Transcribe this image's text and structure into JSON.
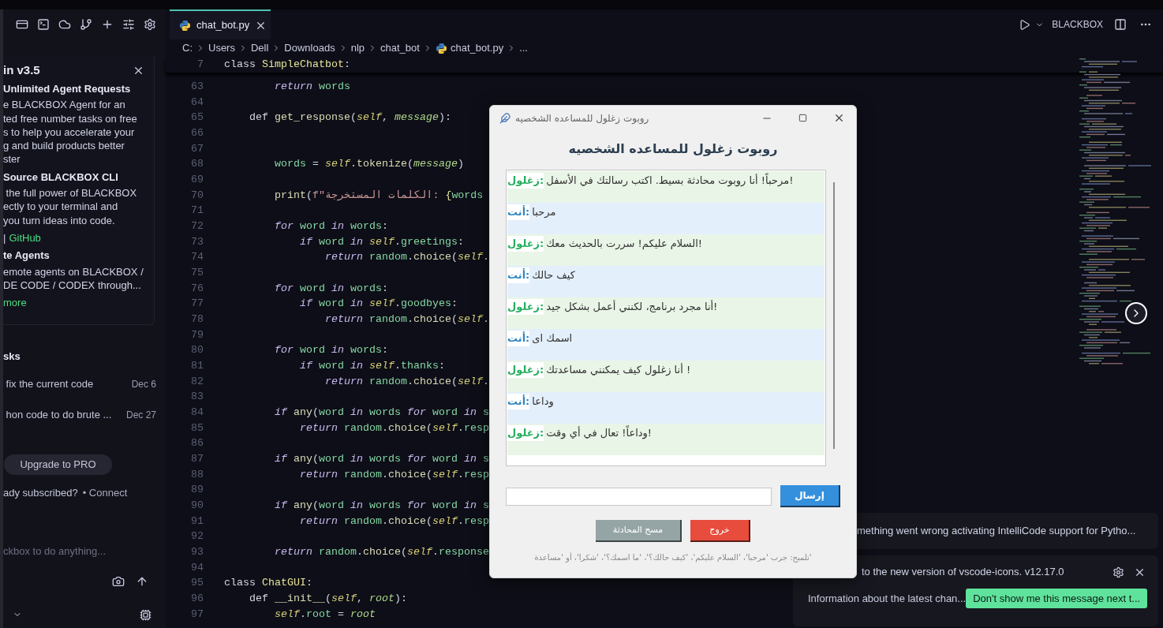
{
  "editor": {
    "tabs": [
      {
        "label": "chat_bot.py",
        "selected": true
      }
    ],
    "toolbar": {
      "label": "BLACKBOX"
    },
    "breadcrumbs": [
      {
        "label": "C:",
        "kind": "folder"
      },
      {
        "label": "Users",
        "kind": "folder"
      },
      {
        "label": "Dell",
        "kind": "folder"
      },
      {
        "label": "Downloads",
        "kind": "folder"
      },
      {
        "label": "nlp",
        "kind": "folder"
      },
      {
        "label": "chat_bot",
        "kind": "folder"
      },
      {
        "label": "chat_bot.py",
        "kind": "file"
      },
      {
        "label": "...",
        "kind": "more"
      }
    ],
    "sticky_lines": [
      {
        "number": "7",
        "code": [
          {
            "kind": "decl",
            "text": "class "
          },
          {
            "kind": "cls",
            "text": "SimpleChatbot"
          },
          {
            "kind": "p",
            "text": ":"
          }
        ]
      }
    ],
    "lines": [
      {
        "number": "63",
        "code": [
          {
            "kind": "kw",
            "text": "        return "
          },
          {
            "kind": "id",
            "text": "words"
          }
        ]
      },
      {
        "number": "64"
      },
      {
        "number": "65",
        "code": [
          {
            "kind": "decl",
            "text": "    def "
          },
          {
            "kind": "fn",
            "text": "get_response"
          },
          {
            "kind": "p",
            "text": "("
          },
          {
            "kind": "self",
            "text": "self"
          },
          {
            "kind": "p",
            "text": ", "
          },
          {
            "kind": "param",
            "text": "message"
          },
          {
            "kind": "p",
            "text": "):"
          }
        ]
      },
      {
        "number": "66"
      },
      {
        "number": "67"
      },
      {
        "number": "68",
        "code": [
          {
            "kind": "id",
            "text": "        words"
          },
          {
            "kind": "p",
            "text": " = "
          },
          {
            "kind": "self",
            "text": "self"
          },
          {
            "kind": "p",
            "text": "."
          },
          {
            "kind": "fn",
            "text": "tokenize"
          },
          {
            "kind": "p",
            "text": "("
          },
          {
            "kind": "param",
            "text": "message"
          },
          {
            "kind": "p",
            "text": ")"
          }
        ]
      },
      {
        "number": "69"
      },
      {
        "number": "70",
        "code": [
          {
            "kind": "fn",
            "text": "        print"
          },
          {
            "kind": "p",
            "text": "("
          },
          {
            "kind": "str",
            "text": "f\"الكلمات المستخرجة: "
          },
          {
            "kind": "cls",
            "text": "{"
          },
          {
            "kind": "id",
            "text": "words"
          }
        ]
      },
      {
        "number": "71"
      },
      {
        "number": "72",
        "code": [
          {
            "kind": "kw",
            "text": "        for "
          },
          {
            "kind": "id",
            "text": "word "
          },
          {
            "kind": "kw",
            "text": "in "
          },
          {
            "kind": "id",
            "text": "words"
          },
          {
            "kind": "p",
            "text": ":"
          }
        ]
      },
      {
        "number": "73",
        "code": [
          {
            "kind": "kw",
            "text": "            if "
          },
          {
            "kind": "id",
            "text": "word "
          },
          {
            "kind": "kw",
            "text": "in "
          },
          {
            "kind": "self",
            "text": "self"
          },
          {
            "kind": "p",
            "text": "."
          },
          {
            "kind": "id",
            "text": "greetings"
          },
          {
            "kind": "p",
            "text": ":"
          }
        ]
      },
      {
        "number": "74",
        "code": [
          {
            "kind": "kw",
            "text": "                return "
          },
          {
            "kind": "id",
            "text": "random"
          },
          {
            "kind": "p",
            "text": "."
          },
          {
            "kind": "fn",
            "text": "choice"
          },
          {
            "kind": "p",
            "text": "("
          },
          {
            "kind": "self",
            "text": "self"
          },
          {
            "kind": "p",
            "text": "."
          }
        ]
      },
      {
        "number": "75"
      },
      {
        "number": "76",
        "code": [
          {
            "kind": "kw",
            "text": "        for "
          },
          {
            "kind": "id",
            "text": "word "
          },
          {
            "kind": "kw",
            "text": "in "
          },
          {
            "kind": "id",
            "text": "words"
          },
          {
            "kind": "p",
            "text": ":"
          }
        ]
      },
      {
        "number": "77",
        "code": [
          {
            "kind": "kw",
            "text": "            if "
          },
          {
            "kind": "id",
            "text": "word "
          },
          {
            "kind": "kw",
            "text": "in "
          },
          {
            "kind": "self",
            "text": "self"
          },
          {
            "kind": "p",
            "text": "."
          },
          {
            "kind": "id",
            "text": "goodbyes"
          },
          {
            "kind": "p",
            "text": ":"
          }
        ]
      },
      {
        "number": "78",
        "code": [
          {
            "kind": "kw",
            "text": "                return "
          },
          {
            "kind": "id",
            "text": "random"
          },
          {
            "kind": "p",
            "text": "."
          },
          {
            "kind": "fn",
            "text": "choice"
          },
          {
            "kind": "p",
            "text": "("
          },
          {
            "kind": "self",
            "text": "self"
          },
          {
            "kind": "p",
            "text": "."
          }
        ]
      },
      {
        "number": "79"
      },
      {
        "number": "80",
        "code": [
          {
            "kind": "kw",
            "text": "        for "
          },
          {
            "kind": "id",
            "text": "word "
          },
          {
            "kind": "kw",
            "text": "in "
          },
          {
            "kind": "id",
            "text": "words"
          },
          {
            "kind": "p",
            "text": ":"
          }
        ]
      },
      {
        "number": "81",
        "code": [
          {
            "kind": "kw",
            "text": "            if "
          },
          {
            "kind": "id",
            "text": "word "
          },
          {
            "kind": "kw",
            "text": "in "
          },
          {
            "kind": "self",
            "text": "self"
          },
          {
            "kind": "p",
            "text": "."
          },
          {
            "kind": "id",
            "text": "thanks"
          },
          {
            "kind": "p",
            "text": ":"
          }
        ]
      },
      {
        "number": "82",
        "code": [
          {
            "kind": "kw",
            "text": "                return "
          },
          {
            "kind": "id",
            "text": "random"
          },
          {
            "kind": "p",
            "text": "."
          },
          {
            "kind": "fn",
            "text": "choice"
          },
          {
            "kind": "p",
            "text": "("
          },
          {
            "kind": "self",
            "text": "self"
          },
          {
            "kind": "p",
            "text": "."
          }
        ]
      },
      {
        "number": "83"
      },
      {
        "number": "84",
        "code": [
          {
            "kind": "kw",
            "text": "        if "
          },
          {
            "kind": "fn",
            "text": "any"
          },
          {
            "kind": "p",
            "text": "("
          },
          {
            "kind": "id",
            "text": "word "
          },
          {
            "kind": "kw",
            "text": "in "
          },
          {
            "kind": "id",
            "text": "words "
          },
          {
            "kind": "kw",
            "text": "for "
          },
          {
            "kind": "id",
            "text": "word "
          },
          {
            "kind": "kw",
            "text": "in "
          },
          {
            "kind": "id",
            "text": "s"
          }
        ]
      },
      {
        "number": "85",
        "code": [
          {
            "kind": "kw",
            "text": "            return "
          },
          {
            "kind": "id",
            "text": "random"
          },
          {
            "kind": "p",
            "text": "."
          },
          {
            "kind": "fn",
            "text": "choice"
          },
          {
            "kind": "p",
            "text": "("
          },
          {
            "kind": "self",
            "text": "self"
          },
          {
            "kind": "p",
            "text": "."
          },
          {
            "kind": "id",
            "text": "resp"
          }
        ]
      },
      {
        "number": "86"
      },
      {
        "number": "87",
        "code": [
          {
            "kind": "kw",
            "text": "        if "
          },
          {
            "kind": "fn",
            "text": "any"
          },
          {
            "kind": "p",
            "text": "("
          },
          {
            "kind": "id",
            "text": "word "
          },
          {
            "kind": "kw",
            "text": "in "
          },
          {
            "kind": "id",
            "text": "words "
          },
          {
            "kind": "kw",
            "text": "for "
          },
          {
            "kind": "id",
            "text": "word "
          },
          {
            "kind": "kw",
            "text": "in "
          },
          {
            "kind": "id",
            "text": "s"
          }
        ]
      },
      {
        "number": "88",
        "code": [
          {
            "kind": "kw",
            "text": "            return "
          },
          {
            "kind": "id",
            "text": "random"
          },
          {
            "kind": "p",
            "text": "."
          },
          {
            "kind": "fn",
            "text": "choice"
          },
          {
            "kind": "p",
            "text": "("
          },
          {
            "kind": "self",
            "text": "self"
          },
          {
            "kind": "p",
            "text": "."
          },
          {
            "kind": "id",
            "text": "resp"
          }
        ]
      },
      {
        "number": "89"
      },
      {
        "number": "90",
        "code": [
          {
            "kind": "kw",
            "text": "        if "
          },
          {
            "kind": "fn",
            "text": "any"
          },
          {
            "kind": "p",
            "text": "("
          },
          {
            "kind": "id",
            "text": "word "
          },
          {
            "kind": "kw",
            "text": "in "
          },
          {
            "kind": "id",
            "text": "words "
          },
          {
            "kind": "kw",
            "text": "for "
          },
          {
            "kind": "id",
            "text": "word "
          },
          {
            "kind": "kw",
            "text": "in "
          },
          {
            "kind": "id",
            "text": "s"
          }
        ]
      },
      {
        "number": "91",
        "code": [
          {
            "kind": "kw",
            "text": "            return "
          },
          {
            "kind": "id",
            "text": "random"
          },
          {
            "kind": "p",
            "text": "."
          },
          {
            "kind": "fn",
            "text": "choice"
          },
          {
            "kind": "p",
            "text": "("
          },
          {
            "kind": "self",
            "text": "self"
          },
          {
            "kind": "p",
            "text": "."
          },
          {
            "kind": "id",
            "text": "resp"
          }
        ]
      },
      {
        "number": "92"
      },
      {
        "number": "93",
        "code": [
          {
            "kind": "kw",
            "text": "        return "
          },
          {
            "kind": "id",
            "text": "random"
          },
          {
            "kind": "p",
            "text": "."
          },
          {
            "kind": "fn",
            "text": "choice"
          },
          {
            "kind": "p",
            "text": "("
          },
          {
            "kind": "self",
            "text": "self"
          },
          {
            "kind": "p",
            "text": "."
          },
          {
            "kind": "id",
            "text": "response"
          }
        ]
      },
      {
        "number": "94"
      },
      {
        "number": "95",
        "code": [
          {
            "kind": "decl",
            "text": "class "
          },
          {
            "kind": "cls",
            "text": "ChatGUI"
          },
          {
            "kind": "p",
            "text": ":"
          }
        ]
      },
      {
        "number": "96",
        "code": [
          {
            "kind": "decl",
            "text": "    def "
          },
          {
            "kind": "fn",
            "text": "__init__"
          },
          {
            "kind": "p",
            "text": "("
          },
          {
            "kind": "self",
            "text": "self"
          },
          {
            "kind": "p",
            "text": ", "
          },
          {
            "kind": "param",
            "text": "root"
          },
          {
            "kind": "p",
            "text": "):"
          }
        ]
      },
      {
        "number": "97",
        "code": [
          {
            "kind": "self",
            "text": "        self"
          },
          {
            "kind": "p",
            "text": "."
          },
          {
            "kind": "id",
            "text": "root"
          },
          {
            "kind": "p",
            "text": " = "
          },
          {
            "kind": "param",
            "text": "root"
          }
        ]
      }
    ]
  },
  "sidebar": {
    "announcement": {
      "title": "in v3.5",
      "sections": [
        {
          "heading": "Unlimited Agent Requests",
          "lines": [
            "e BLACKBOX Agent for an",
            "ted free number tasks on free",
            "s to help you accelerate your",
            "g and build products better",
            "ster"
          ]
        },
        {
          "heading": "Source BLACKBOX CLI",
          "lines": [
            " the full power of BLACKBOX",
            "ectly to your terminal and",
            "you turn ideas into code."
          ],
          "footer": {
            "prefix": "|",
            "link": "GitHub"
          }
        },
        {
          "heading": "te Agents",
          "lines": [
            "emote agents on BLACKBOX /",
            "DE CODE / CODEX through..."
          ],
          "footer": {
            "link": "more"
          }
        }
      ]
    },
    "tasks": {
      "heading": "sks",
      "items": [
        {
          "title": "fix the current code",
          "date": "Dec 6"
        },
        {
          "title": "hon code to do brute ...",
          "date": "Dec 27"
        }
      ]
    },
    "upgrade_button": "Upgrade to PRO",
    "subscribed": {
      "text": "ady subscribed?",
      "link": "• Connect"
    },
    "prompt": {
      "placeholder": "ckbox to do anything..."
    }
  },
  "dialog": {
    "title": "روبوت زغلول للمساعده الشخصيه",
    "heading": "روبوت زغلول للمساعده الشخصيه",
    "messages": [
      {
        "kind": "bot",
        "sender": "زغلول:",
        "text": "مرحباً! أنا روبوت محادثة بسيط. اكتب رسالتك في الأسفل!"
      },
      {
        "kind": "user",
        "sender": "أنت:",
        "text": "مرحبا"
      },
      {
        "kind": "bot",
        "sender": "زغلول:",
        "text": "السلام عليكم! سررت بالحديث معك!"
      },
      {
        "kind": "user",
        "sender": "أنت:",
        "text": "كيف حالك"
      },
      {
        "kind": "bot",
        "sender": "زغلول:",
        "text": "أنا مجرد برنامج، لكنني أعمل بشكل جيد!"
      },
      {
        "kind": "user",
        "sender": "أنت:",
        "text": "اسمك اى"
      },
      {
        "kind": "bot",
        "sender": "زغلول:",
        "text": "أنا زغلول كيف يمكنني مساعدتك !"
      },
      {
        "kind": "user",
        "sender": "أنت:",
        "text": "وداعا"
      },
      {
        "kind": "bot",
        "sender": "زغلول:",
        "text": "وداعاً! تعال في أي وقت!"
      }
    ],
    "send_button": "إرسال",
    "clear_button": "مسح المحادثة",
    "exit_button": "خروج",
    "hint": "تلميح: جرب 'مرحبا'، 'السلام عليكم'، 'كيف حالك؟'، 'ما اسمك؟'، 'شكرا'، أو 'مساعدة'"
  },
  "notifications": [
    {
      "kind": "error",
      "message": "mething went wrong activating IntelliCode support for Pytho..."
    },
    {
      "kind": "info",
      "message": "to the new version of vscode-icons. v12.17.0",
      "link": "Information about the latest chan...",
      "button": "Don't show me this message next t..."
    }
  ]
}
